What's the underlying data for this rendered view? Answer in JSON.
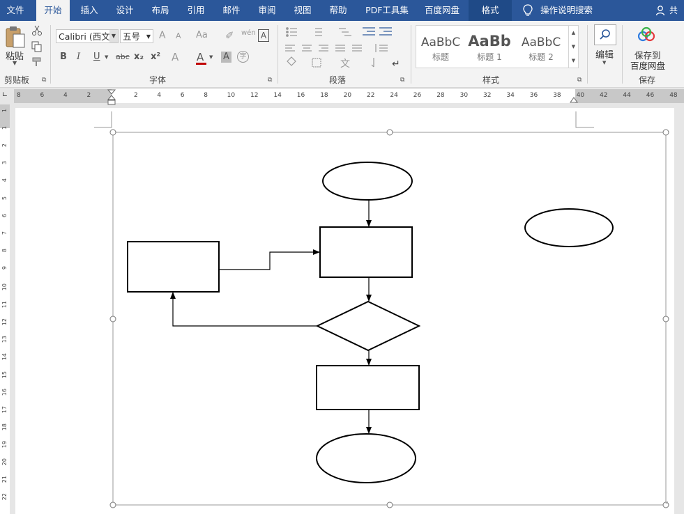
{
  "tabs": [
    "文件",
    "开始",
    "插入",
    "设计",
    "布局",
    "引用",
    "邮件",
    "审阅",
    "视图",
    "帮助",
    "PDF工具集",
    "百度网盘",
    "格式"
  ],
  "active_tab": "开始",
  "tell_me": "操作说明搜索",
  "share": "共享",
  "clipboard": {
    "paste": "粘贴",
    "group": "剪贴板"
  },
  "font": {
    "name": "Calibri (西文",
    "size": "五号",
    "group": "字体",
    "bold": "B",
    "italic": "I",
    "underline": "U",
    "strike": "abc",
    "subscript": "x₂",
    "superscript": "x²",
    "grow": "A",
    "shrink": "A",
    "case": "Aa",
    "phonetic": "wén",
    "border": "A",
    "font_color": "A",
    "highlight": "A"
  },
  "paragraph": {
    "group": "段落"
  },
  "styles": {
    "group": "样式",
    "items": [
      {
        "sample": "AaBbC",
        "name": "标题"
      },
      {
        "sample": "AaBb",
        "name": "标题 1"
      },
      {
        "sample": "AaBbC",
        "name": "标题 2"
      }
    ]
  },
  "editing": {
    "label": "编辑"
  },
  "save": {
    "line1": "保存到",
    "line2": "百度网盘",
    "group": "保存"
  },
  "ruler": {
    "h_left": [
      "8",
      "6",
      "4",
      "2"
    ],
    "h_right": [
      "2",
      "4",
      "6",
      "8",
      "10",
      "12",
      "14",
      "16",
      "18",
      "20",
      "22",
      "24",
      "26",
      "28",
      "30",
      "32",
      "34",
      "36",
      "38",
      "40",
      "42",
      "44",
      "46",
      "48"
    ],
    "v": [
      "1",
      "1",
      "2",
      "3",
      "4",
      "5",
      "6",
      "7",
      "8",
      "9",
      "10",
      "11",
      "12",
      "13",
      "14",
      "15",
      "16",
      "17",
      "18",
      "19",
      "20",
      "21",
      "22"
    ]
  },
  "colors": {
    "accent": "#2b579a",
    "font_red": "#c00000"
  }
}
